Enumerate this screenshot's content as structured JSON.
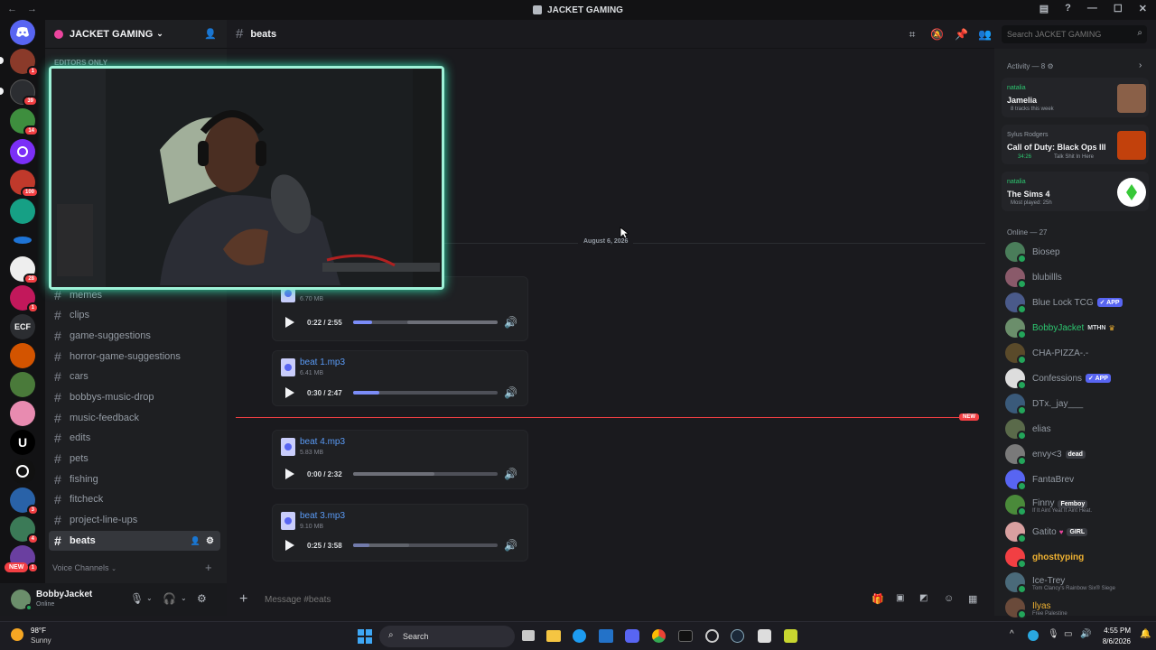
{
  "window": {
    "title": "JACKET GAMING"
  },
  "server": {
    "name": "JACKET GAMING",
    "section_label": "EDITORS ONLY",
    "voice_label": "Voice Channels"
  },
  "channels": [
    {
      "name": "memes"
    },
    {
      "name": "clips"
    },
    {
      "name": "game-suggestions"
    },
    {
      "name": "horror-game-suggestions"
    },
    {
      "name": "cars"
    },
    {
      "name": "bobbys-music-drop"
    },
    {
      "name": "music-feedback"
    },
    {
      "name": "edits"
    },
    {
      "name": "pets"
    },
    {
      "name": "fishing"
    },
    {
      "name": "fitcheck"
    },
    {
      "name": "project-line-ups"
    },
    {
      "name": "beats"
    }
  ],
  "rail": {
    "badges": [
      "1",
      "39",
      "14",
      "100",
      "28",
      "1",
      "3",
      "1",
      "4"
    ],
    "ecf_label": "ECF",
    "new_label": "NEW"
  },
  "user": {
    "name": "BobbyJacket",
    "status": "Online"
  },
  "chat": {
    "channel": "beats",
    "date_divider": "August 6, 2026",
    "new_label": "NEW",
    "composer_placeholder": "Message #beats",
    "attachments": [
      {
        "name": "",
        "size": "6.70 MB",
        "time": "0:22 / 2:55",
        "progress": 0.13
      },
      {
        "name": "beat 1.mp3",
        "size": "6.41 MB",
        "time": "0:30 / 2:47",
        "progress": 0.18
      },
      {
        "name": "beat 4.mp3",
        "size": "5.83 MB",
        "time": "0:00 / 2:32",
        "progress": 0.0
      },
      {
        "name": "beat 3.mp3",
        "size": "9.10 MB",
        "time": "0:25 / 3:58",
        "progress": 0.11
      }
    ]
  },
  "search": {
    "placeholder": "Search JACKET GAMING"
  },
  "activity": {
    "header": "Activity — 8",
    "cards": [
      {
        "user": "natalia",
        "title": "Jamelia",
        "detail": "8 tracks this week",
        "color": "#2dc770"
      },
      {
        "user": "Sylus Rodgers",
        "title": "Call of Duty: Black Ops III",
        "detail": "34:26",
        "detail2": "Talk Shit In Here",
        "color": "#949ba4"
      },
      {
        "user": "natalia",
        "title": "The Sims 4",
        "detail": "Most played: 25h",
        "color": "#2dc770"
      }
    ]
  },
  "members": {
    "header": "Online — 27",
    "list": [
      {
        "name": "Biosep"
      },
      {
        "name": "blubillls"
      },
      {
        "name": "Blue Lock TCG",
        "tag": "✓ APP"
      },
      {
        "name": "BobbyJacket",
        "tag": "MTHN",
        "color": "#2dc770"
      },
      {
        "name": "CHA-PIZZA-.-"
      },
      {
        "name": "Confessions",
        "tag": "✓ APP"
      },
      {
        "name": "DTx._jay___"
      },
      {
        "name": "elias"
      },
      {
        "name": "envy<3",
        "tag": "dead"
      },
      {
        "name": "FantaBrev"
      },
      {
        "name": "Finny",
        "tag": "Femboy",
        "status": "If It Aint Yeat It Aint Heat."
      },
      {
        "name": "Gatito",
        "tag": "GIRL"
      },
      {
        "name": "ghosttyping",
        "color": "#f0b232"
      },
      {
        "name": "Ice-Trey",
        "status": "Tom Clancy's Rainbow Six® Siege"
      },
      {
        "name": "Ilyas",
        "status": "Free Palestine",
        "color": "#f0b232"
      }
    ]
  },
  "taskbar": {
    "weather_temp": "98°F",
    "weather_desc": "Sunny",
    "search_label": "Search",
    "time": "4:55 PM",
    "date": "8/6/2026"
  },
  "colors": {
    "accent": "#5865f2",
    "online": "#23a55a",
    "new_line": "#f23f43",
    "webcam_border": "#9ff2d8"
  }
}
